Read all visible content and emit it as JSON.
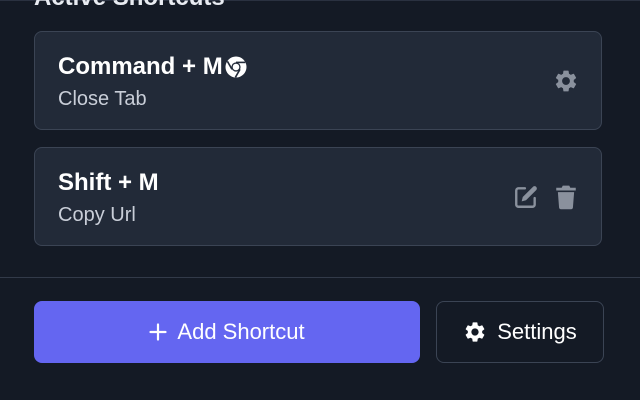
{
  "section": {
    "title": "Active Shortcuts"
  },
  "shortcuts": [
    {
      "keys": "Command + M",
      "action": "Close Tab",
      "badge_icon": "chrome-icon",
      "controls": [
        "gear-icon"
      ]
    },
    {
      "keys": "Shift + M",
      "action": "Copy Url",
      "controls": [
        "edit-icon",
        "trash-icon"
      ]
    }
  ],
  "footer": {
    "add_label": "Add Shortcut",
    "add_icon": "plus-icon",
    "settings_label": "Settings",
    "settings_icon": "gear-icon"
  },
  "colors": {
    "background": "#141a25",
    "card": "#222a38",
    "card_border": "#3b4454",
    "accent": "#6466f1",
    "muted_icon": "#8a919d"
  }
}
